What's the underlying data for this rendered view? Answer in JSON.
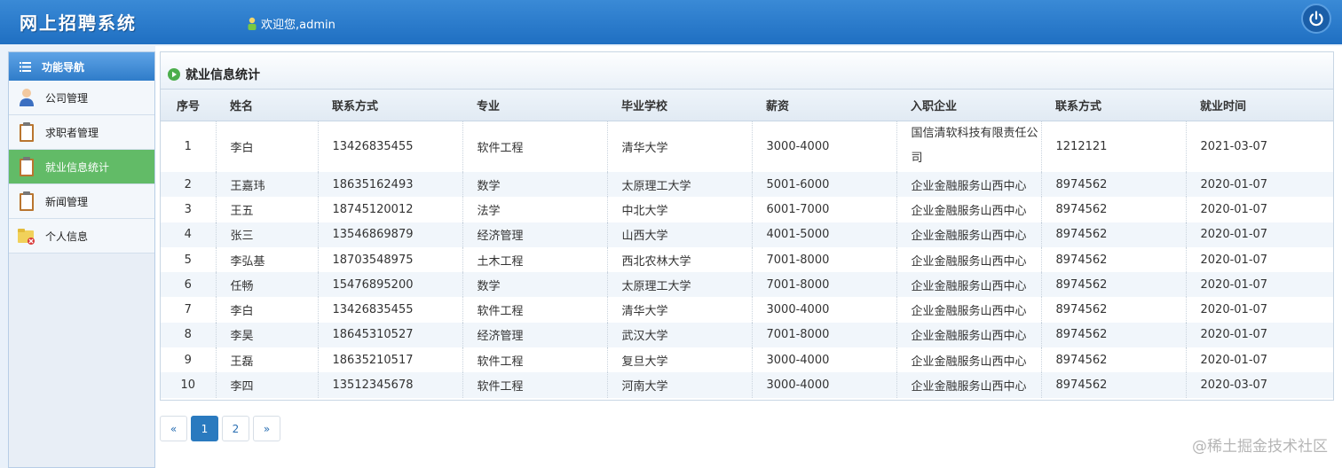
{
  "header": {
    "app_title": "网上招聘系统",
    "welcome": "欢迎您,admin"
  },
  "sidebar": {
    "title": "功能导航",
    "items": [
      {
        "label": "公司管理",
        "icon": "user-icon"
      },
      {
        "label": "求职者管理",
        "icon": "clipboard-icon"
      },
      {
        "label": "就业信息统计",
        "icon": "clipboard-icon",
        "active": true
      },
      {
        "label": "新闻管理",
        "icon": "clipboard-icon"
      },
      {
        "label": "个人信息",
        "icon": "folder-icon"
      }
    ]
  },
  "main": {
    "panel_title": "就业信息统计",
    "columns": [
      "序号",
      "姓名",
      "联系方式",
      "专业",
      "毕业学校",
      "薪资",
      "入职企业",
      "联系方式",
      "就业时间"
    ],
    "rows": [
      [
        "1",
        "李白",
        "13426835455",
        "软件工程",
        "清华大学",
        "3000-4000",
        "国信清软科技有限责任公司",
        "1212121",
        "2021-03-07"
      ],
      [
        "2",
        "王嘉玮",
        "18635162493",
        "数学",
        "太原理工大学",
        "5001-6000",
        "企业金融服务山西中心",
        "8974562",
        "2020-01-07"
      ],
      [
        "3",
        "王五",
        "18745120012",
        "法学",
        "中北大学",
        "6001-7000",
        "企业金融服务山西中心",
        "8974562",
        "2020-01-07"
      ],
      [
        "4",
        "张三",
        "13546869879",
        "经济管理",
        "山西大学",
        "4001-5000",
        "企业金融服务山西中心",
        "8974562",
        "2020-01-07"
      ],
      [
        "5",
        "李弘基",
        "18703548975",
        "土木工程",
        "西北农林大学",
        "7001-8000",
        "企业金融服务山西中心",
        "8974562",
        "2020-01-07"
      ],
      [
        "6",
        "任畅",
        "15476895200",
        "数学",
        "太原理工大学",
        "7001-8000",
        "企业金融服务山西中心",
        "8974562",
        "2020-01-07"
      ],
      [
        "7",
        "李白",
        "13426835455",
        "软件工程",
        "清华大学",
        "3000-4000",
        "企业金融服务山西中心",
        "8974562",
        "2020-01-07"
      ],
      [
        "8",
        "李昊",
        "18645310527",
        "经济管理",
        "武汉大学",
        "7001-8000",
        "企业金融服务山西中心",
        "8974562",
        "2020-01-07"
      ],
      [
        "9",
        "王磊",
        "18635210517",
        "软件工程",
        "复旦大学",
        "3000-4000",
        "企业金融服务山西中心",
        "8974562",
        "2020-01-07"
      ],
      [
        "10",
        "李四",
        "13512345678",
        "软件工程",
        "河南大学",
        "3000-4000",
        "企业金融服务山西中心",
        "8974562",
        "2020-03-07"
      ]
    ]
  },
  "pagination": {
    "prev": "«",
    "pages": [
      "1",
      "2"
    ],
    "current": "1",
    "next": "»"
  },
  "watermark": "@稀土掘金技术社区",
  "colors": {
    "header_blue": "#2a7bcc",
    "active_green": "#62bb67",
    "page_active": "#2a7abf"
  }
}
